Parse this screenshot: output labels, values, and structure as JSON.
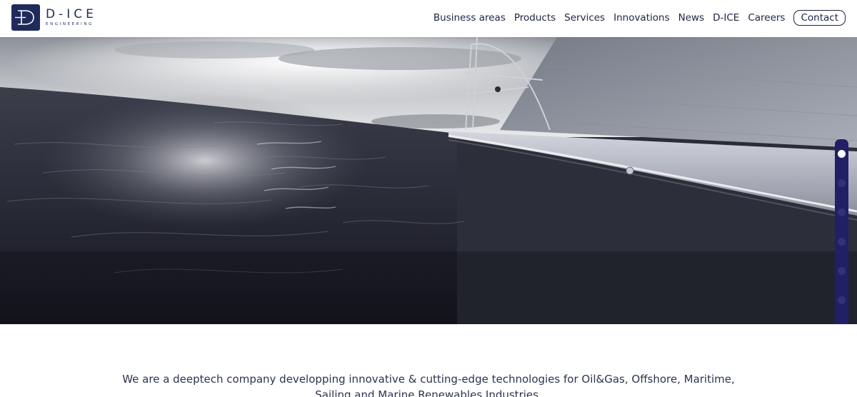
{
  "brand": {
    "logo_letter": "D",
    "name": "D-ICE",
    "subtitle": "ENGINEERING",
    "color": "#1f2a5c"
  },
  "nav": {
    "items": [
      {
        "label": "Business areas"
      },
      {
        "label": "Products"
      },
      {
        "label": "Services"
      },
      {
        "label": "Innovations"
      },
      {
        "label": "News"
      },
      {
        "label": "D-ICE"
      },
      {
        "label": "Careers"
      }
    ],
    "contact_label": "Contact"
  },
  "hero": {
    "image": "sailboat-at-sea",
    "slider": {
      "count": 7,
      "active_index": 0,
      "rail_color": "#211f66"
    }
  },
  "intro": {
    "line1": "We are a deeptech company developping innovative & cutting-edge technologies for Oil&Gas, Offshore, Maritime,",
    "line2": "Sailing and Marine Renewables Industries."
  }
}
